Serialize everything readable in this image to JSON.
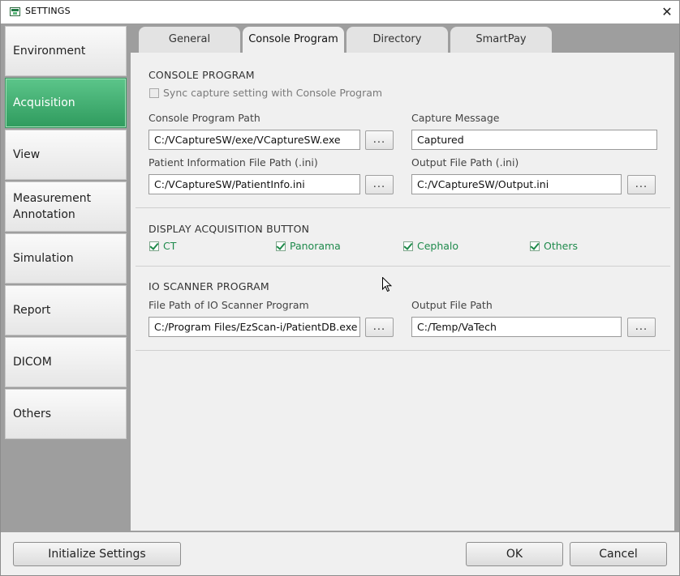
{
  "window": {
    "title": "SETTINGS",
    "close_label": "✕"
  },
  "sidebar": {
    "items": [
      {
        "label": "Environment"
      },
      {
        "label": "Acquisition"
      },
      {
        "label": "View"
      },
      {
        "label": "Measurement Annotation"
      },
      {
        "label": "Simulation"
      },
      {
        "label": "Report"
      },
      {
        "label": "DICOM"
      },
      {
        "label": "Others"
      }
    ],
    "active_index": 1
  },
  "tabs": [
    {
      "label": "General"
    },
    {
      "label": "Console Program"
    },
    {
      "label": "Directory"
    },
    {
      "label": "SmartPay"
    }
  ],
  "active_tab_index": 1,
  "console_program": {
    "section_title": "CONSOLE PROGRAM",
    "sync_checkbox_label": "Sync capture setting with Console Program",
    "sync_checked": false,
    "console_program_path_label": "Console Program Path",
    "console_program_path_value": "C:/VCaptureSW/exe/VCaptureSW.exe",
    "capture_message_label": "Capture Message",
    "capture_message_value": "Captured",
    "patient_info_path_label": "Patient Information File Path (.ini)",
    "patient_info_path_value": "C:/VCaptureSW/PatientInfo.ini",
    "output_file_path_label": "Output File Path (.ini)",
    "output_file_path_value": "C:/VCaptureSW/Output.ini",
    "browse_label": "..."
  },
  "display_acquisition": {
    "section_title": "DISPLAY ACQUISITION BUTTON",
    "options": [
      {
        "label": "CT",
        "checked": true
      },
      {
        "label": "Panorama",
        "checked": true
      },
      {
        "label": "Cephalo",
        "checked": true
      },
      {
        "label": "Others",
        "checked": true
      }
    ]
  },
  "io_scanner": {
    "section_title": "IO SCANNER PROGRAM",
    "scanner_path_label": "File Path of IO Scanner Program",
    "scanner_path_value": "C:/Program Files/EzScan-i/PatientDB.exe",
    "output_path_label": "Output File Path",
    "output_path_value": "C:/Temp/VaTech",
    "browse_label": "..."
  },
  "footer": {
    "initialize_label": "Initialize Settings",
    "ok_label": "OK",
    "cancel_label": "Cancel"
  },
  "colors": {
    "accent_green": "#3aa76a",
    "check_text_green": "#1f8a4c"
  }
}
